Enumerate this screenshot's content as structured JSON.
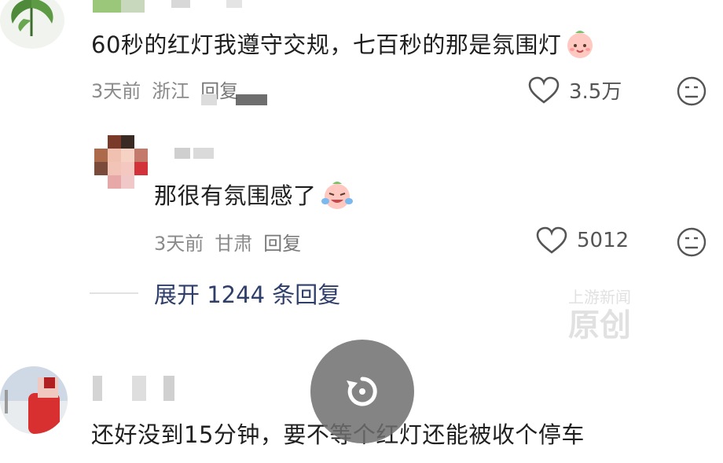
{
  "comments": [
    {
      "text": "60秒的红灯我遵守交规，七百秒的那是氛围灯",
      "emoji": "smile-peach-emoji",
      "meta": {
        "time": "3天前",
        "location": "浙江",
        "reply": "回复"
      },
      "likes": "3.5万"
    }
  ],
  "reply": {
    "text": "那很有氛围感了",
    "emoji": "crying-laugh-emoji",
    "meta": {
      "time": "3天前",
      "location": "甘肃",
      "reply": "回复"
    },
    "likes": "5012"
  },
  "expand_label": "展开 1244 条回复",
  "watermark": {
    "line1": "上游新闻",
    "line2": "原创"
  },
  "third_comment": {
    "text": "还好没到15分钟，要不等个红灯还能被收个停车"
  },
  "icons": {
    "heart": "heart-icon",
    "dislike": "dislike-face-icon",
    "replay": "replay-icon"
  },
  "colors": {
    "text": "#1f1f1f",
    "meta": "#8a8a8a",
    "expand": "#2f3f6a"
  }
}
